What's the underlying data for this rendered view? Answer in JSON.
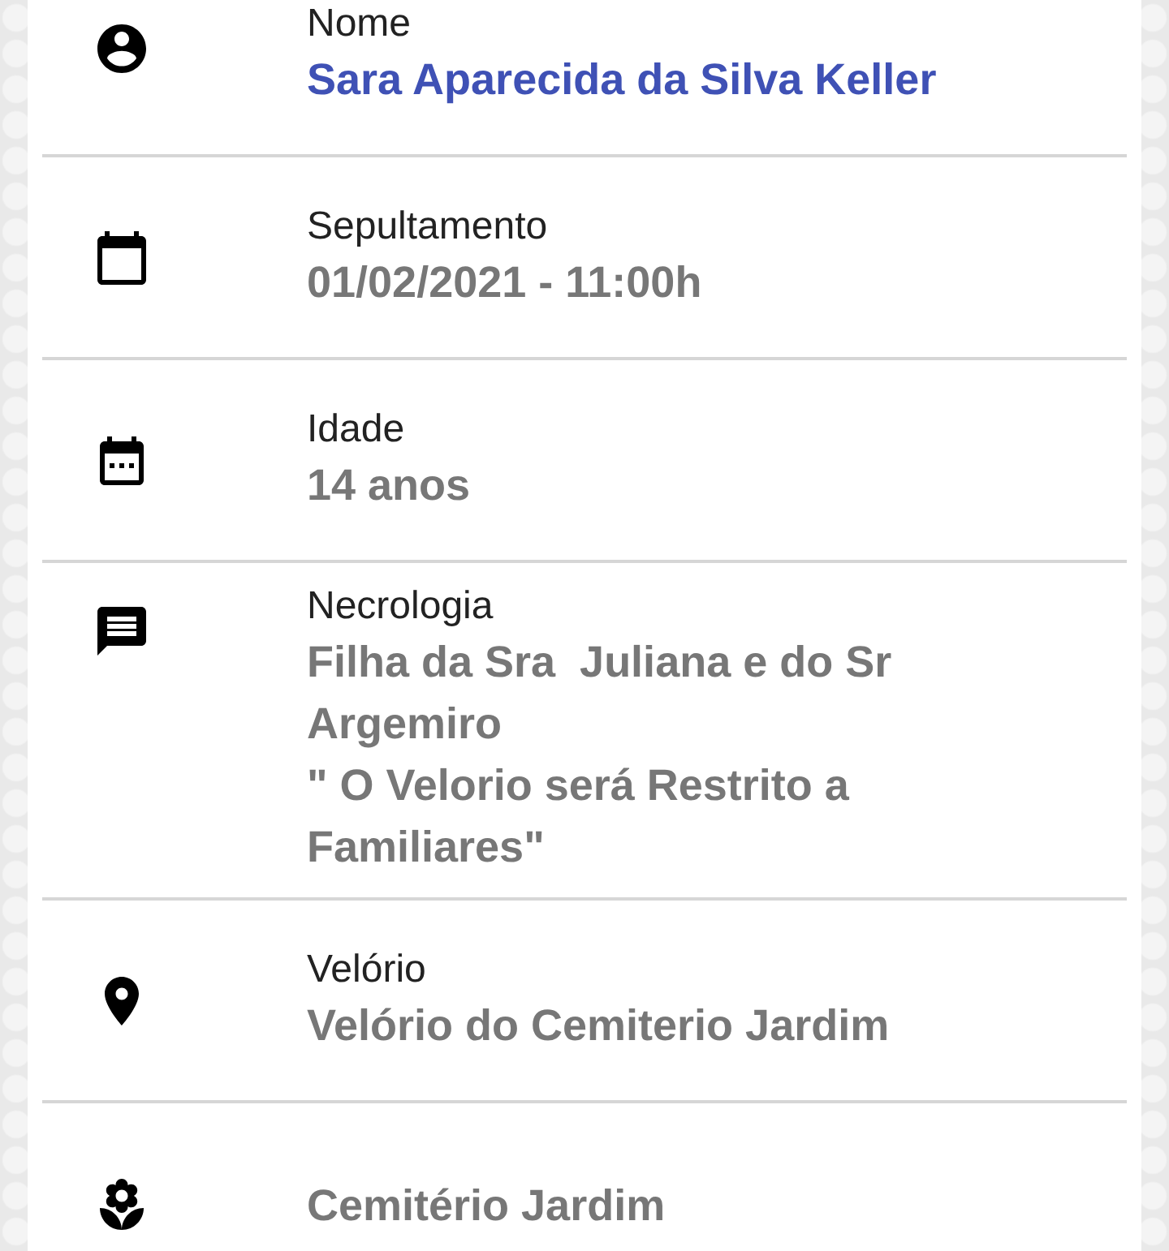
{
  "fields": [
    {
      "label": "Nome",
      "value": [
        "Sara Aparecida da Silva Keller"
      ],
      "highlighted": true
    },
    {
      "label": "Sepultamento",
      "value": [
        "01/02/2021 - 11:00h"
      ],
      "highlighted": false
    },
    {
      "label": "Idade",
      "value": [
        "14 anos"
      ],
      "highlighted": false
    },
    {
      "label": "Necrologia",
      "value": [
        "Filha da Sra  Juliana e do Sr",
        "Argemiro",
        "\" O Velorio será Restrito a",
        "Familiares\""
      ],
      "highlighted": false
    },
    {
      "label": "Velório",
      "value": [
        "Velório do Cemiterio Jardim"
      ],
      "highlighted": false
    },
    {
      "value": [
        "Cemitério Jardim"
      ],
      "highlighted": false
    }
  ]
}
